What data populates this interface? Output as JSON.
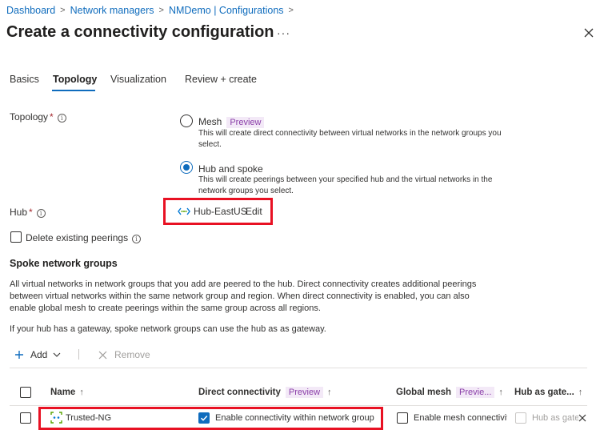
{
  "breadcrumb": {
    "items": [
      "Dashboard",
      "Network managers",
      "NMDemo | Configurations"
    ],
    "separator": ">"
  },
  "page": {
    "title": "Create a connectivity configuration",
    "more_glyph": "···"
  },
  "tabs": [
    {
      "label": "Basics",
      "active": false
    },
    {
      "label": "Topology",
      "active": true
    },
    {
      "label": "Visualization",
      "active": false
    },
    {
      "label": "Review + create",
      "active": false
    }
  ],
  "topology": {
    "label": "Topology",
    "required_mark": "*",
    "info_glyph": "i",
    "options": [
      {
        "label": "Mesh",
        "badge": "Preview",
        "selected": false,
        "description": "This will create direct connectivity between virtual networks in the network groups you select."
      },
      {
        "label": "Hub and spoke",
        "badge": "",
        "selected": true,
        "description": "This will create peerings between your specified hub and the virtual networks in the network groups you select."
      }
    ]
  },
  "hub": {
    "label": "Hub",
    "required_mark": "*",
    "value": "Hub-EastUS",
    "edit_label": "Edit",
    "icon": "virtual-network-icon"
  },
  "delete_peerings": {
    "label": "Delete existing peerings",
    "checked": false
  },
  "spoke": {
    "title": "Spoke network groups",
    "description": "All virtual networks in network groups that you add are peered to the hub. Direct connectivity creates additional peerings between virtual networks within the same network group and region. When direct connectivity is enabled, you can also enable global mesh to create peerings within the same group across all regions.",
    "gateway_note": "If your hub has a gateway, spoke network groups can use the hub as as gateway."
  },
  "toolbar": {
    "add_label": "Add",
    "remove_label": "Remove"
  },
  "table": {
    "columns": [
      {
        "label": "Name",
        "badge": "",
        "sort": "↑"
      },
      {
        "label": "Direct connectivity",
        "badge": "Preview",
        "sort": "↑"
      },
      {
        "label": "Global mesh",
        "badge": "Previe...",
        "sort": "↑"
      },
      {
        "label": "Hub as gate...",
        "badge": "",
        "sort": "↑"
      }
    ],
    "rows": [
      {
        "name": "Trusted-NG",
        "direct": {
          "label": "Enable connectivity within network group",
          "checked": true
        },
        "global": {
          "label": "Enable mesh connectivit",
          "checked": false
        },
        "gateway": {
          "label": "Hub as gatew",
          "checked": false,
          "disabled": true
        }
      }
    ]
  },
  "colors": {
    "accent": "#0f6cbd",
    "highlight": "#e81123",
    "preview_text": "#8a3ea8",
    "preview_bg": "#f3e9f7"
  }
}
